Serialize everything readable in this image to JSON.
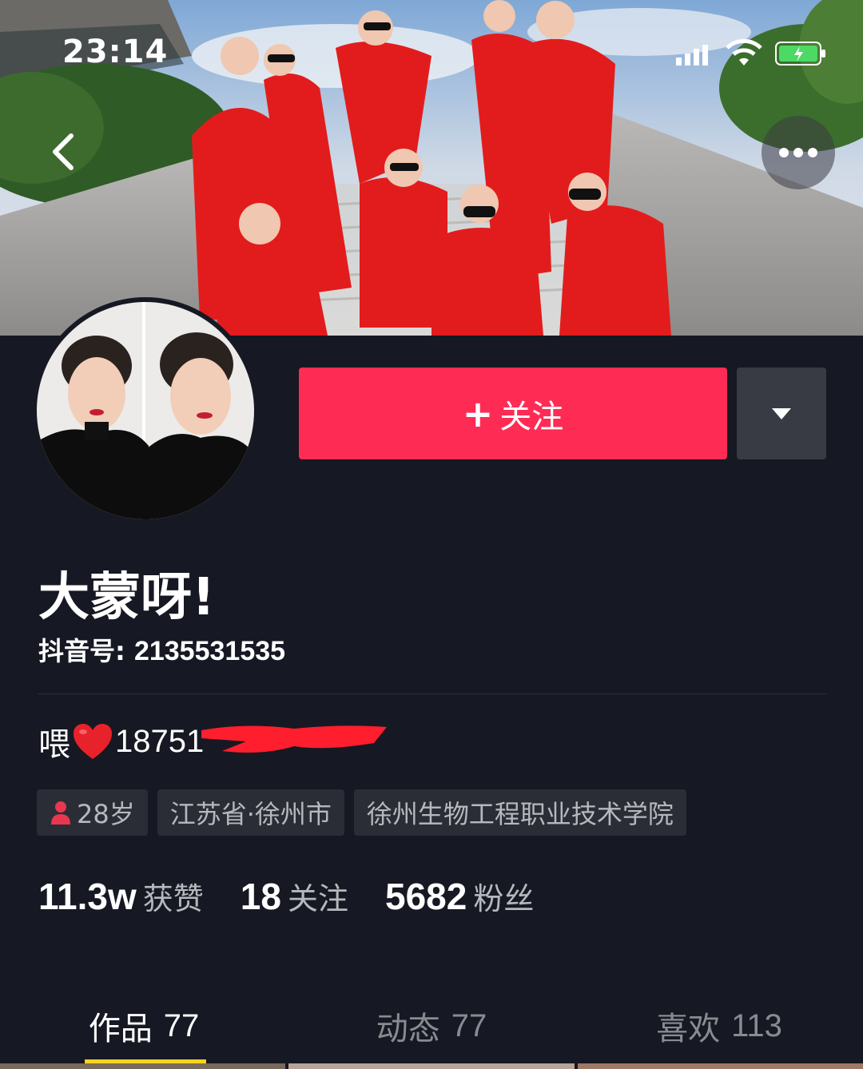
{
  "status_bar": {
    "time": "23:14"
  },
  "profile": {
    "nickname": "大蒙呀!",
    "douyin_id_label": "抖音号: ",
    "douyin_id": "2135531535",
    "bio_prefix": "喂",
    "bio_phone": "18751",
    "follow_label": "关注",
    "follow_plus": "+",
    "tags": {
      "age": "28岁",
      "location": "江苏省·徐州市",
      "school": "徐州生物工程职业技术学院"
    },
    "stats": {
      "likes": {
        "value": "11.3w",
        "label": "获赞"
      },
      "following": {
        "value": "18",
        "label": "关注"
      },
      "followers": {
        "value": "5682",
        "label": "粉丝"
      }
    }
  },
  "tabs": [
    {
      "label": "作品",
      "count": "77",
      "active": true
    },
    {
      "label": "动态",
      "count": "77",
      "active": false
    },
    {
      "label": "喜欢",
      "count": "113",
      "active": false
    }
  ],
  "icons": {
    "back": "chevron-left-icon",
    "more": "more-dots-icon",
    "dropdown": "triangle-down-icon",
    "heart": "heart-icon",
    "person": "person-icon"
  },
  "colors": {
    "background": "#161823",
    "accent": "#fe2c55",
    "tab_indicator": "#fdd31d",
    "secondary_text": "#b7b8bd"
  }
}
